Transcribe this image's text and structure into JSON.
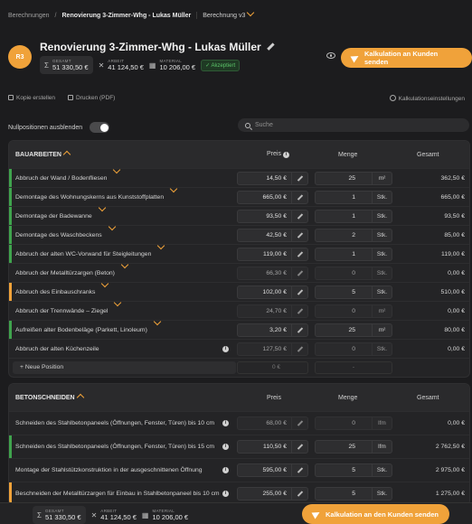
{
  "breadcrumb": {
    "root": "Berechnungen",
    "project": "Renovierung 3-Zimmer-Whg - Lukas Müller",
    "version": "Berechnung v3"
  },
  "header": {
    "avatar": "R3",
    "title": "Renovierung 3-Zimmer-Whg - Lukas Müller",
    "stats": [
      {
        "icon": "Σ",
        "label": "GESAMT",
        "value": "51 330,50 €"
      },
      {
        "icon": "✕",
        "label": "ARBEIT",
        "value": "41 124,50 €"
      },
      {
        "icon": "▦",
        "label": "MATERIAL",
        "value": "10 206,00 €"
      }
    ],
    "status": "✓ Akzeptiert",
    "cta": "Kalkulation an Kunden senden"
  },
  "toolbar": {
    "copy": "Kopie erstellen",
    "print": "Drucken (PDF)",
    "settings": "Kalkulationseinstellungen"
  },
  "filter": {
    "zero_label": "Nullpositionen ausblenden",
    "search_placeholder": "Suche"
  },
  "columns": {
    "price": "Preis",
    "qty": "Menge",
    "total": "Gesamt"
  },
  "sections": [
    {
      "name": "BAUARBEITEN",
      "new_label": "+ Neue Position",
      "new_price_ph": "0 €",
      "new_qty_ph": "-",
      "rows": [
        {
          "desc": "Abbruch der Wand / Bodenfliesen",
          "price": "14,50 €",
          "qty": "25",
          "unit": "m²",
          "total": "362,50 €",
          "bar": "#3fa34d"
        },
        {
          "desc": "Demontage des Wohnungskerns aus Kunststoffplatten",
          "price": "665,00 €",
          "qty": "1",
          "unit": "Stk.",
          "total": "665,00 €",
          "bar": "#3fa34d"
        },
        {
          "desc": "Demontage der Badewanne",
          "price": "93,50 €",
          "qty": "1",
          "unit": "Stk.",
          "total": "93,50 €",
          "bar": "#3fa34d"
        },
        {
          "desc": "Demontage des Waschbeckens",
          "price": "42,50 €",
          "qty": "2",
          "unit": "Stk.",
          "total": "85,00 €",
          "bar": "#3fa34d"
        },
        {
          "desc": "Abbruch der alten WC-Vorwand für Steigleitungen",
          "price": "119,00 €",
          "qty": "1",
          "unit": "Stk.",
          "total": "119,00 €",
          "bar": "#3fa34d"
        },
        {
          "desc": "Abbruch der Metalltürzargen (Beton)",
          "price": "66,30 €",
          "qty": "0",
          "unit": "Stk.",
          "total": "0,00 €",
          "bar": "",
          "dim": true
        },
        {
          "desc": "Abbruch des Einbauschranks",
          "price": "102,00 €",
          "qty": "5",
          "unit": "Stk.",
          "total": "510,00 €",
          "bar": "#f0a23a"
        },
        {
          "desc": "Abbruch der Trennwände – Ziegel",
          "price": "24,70 €",
          "qty": "0",
          "unit": "m²",
          "total": "0,00 €",
          "bar": "",
          "dim": true
        },
        {
          "desc": "Aufreißen alter Bodenbeläge (Parkett, Linoleum)",
          "price": "3,20 €",
          "qty": "25",
          "unit": "m²",
          "total": "80,00 €",
          "bar": "#3fa34d"
        },
        {
          "desc": "Abbruch der alten Küchenzeile",
          "price": "127,50 €",
          "qty": "0",
          "unit": "Stk.",
          "total": "0,00 €",
          "bar": "",
          "dim": true,
          "info": true
        }
      ]
    },
    {
      "name": "BETONSCHNEIDEN",
      "rows": [
        {
          "desc": "Schneiden des Stahlbetonpaneels (Öffnungen, Fenster, Türen) bis 10 cm",
          "price": "68,00 €",
          "qty": "0",
          "unit": "lfm",
          "total": "0,00 €",
          "bar": "",
          "dim": true,
          "info": true
        },
        {
          "desc": "Schneiden des Stahlbetonpaneels (Öffnungen, Fenster, Türen) bis 15 cm",
          "price": "110,50 €",
          "qty": "25",
          "unit": "lfm",
          "total": "2 762,50 €",
          "bar": "#3fa34d",
          "info": true
        },
        {
          "desc": "Montage der Stahlstützkonstruktion in der ausgeschnittenen Öffnung",
          "price": "595,00 €",
          "qty": "5",
          "unit": "Stk.",
          "total": "2 975,00 €",
          "bar": "",
          "info": true
        },
        {
          "desc": "Beschneiden der Metalltürzargen für Einbau in Stahlbetonpaneel bis 10 cm",
          "price": "255,00 €",
          "qty": "5",
          "unit": "Stk.",
          "total": "1 275,00 €",
          "bar": "#f0a23a",
          "info": true
        }
      ]
    }
  ],
  "footer": {
    "stats": [
      {
        "icon": "Σ",
        "label": "GESAMT",
        "value": "51 330,50 €"
      },
      {
        "icon": "✕",
        "label": "ARBEIT",
        "value": "41 124,50 €"
      },
      {
        "icon": "▦",
        "label": "MATERIAL",
        "value": "10 206,00 €"
      }
    ],
    "cta": "Kalkulation an den Kunden senden"
  }
}
